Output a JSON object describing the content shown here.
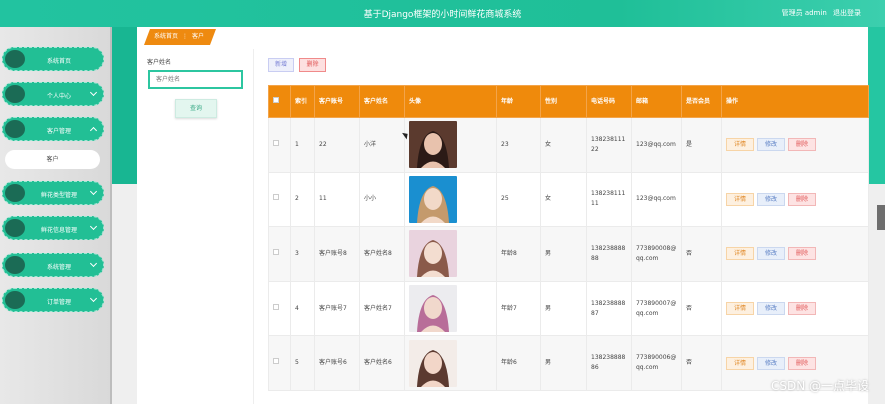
{
  "header": {
    "title": "基于Django框架的小时间鲜花商城系统",
    "user_label": "管理员 admin",
    "logout_label": "退出登录"
  },
  "sidebar": {
    "items": [
      {
        "label": "系统首页",
        "chevron": "none"
      },
      {
        "label": "个人中心",
        "chevron": "down"
      },
      {
        "label": "客户管理",
        "chevron": "up"
      },
      {
        "label": "鲜花类型管理",
        "chevron": "down"
      },
      {
        "label": "鲜花信息管理",
        "chevron": "down"
      },
      {
        "label": "系统管理",
        "chevron": "down"
      },
      {
        "label": "订单管理",
        "chevron": "down"
      }
    ],
    "active_sub": "客户"
  },
  "breadcrumb": {
    "home": "系统首页",
    "separator": "⋮",
    "current": "客户"
  },
  "search": {
    "label": "客户姓名",
    "placeholder": "客户姓名",
    "button": "查询"
  },
  "toolbar": {
    "add_label": "新增",
    "delete_label": "删除"
  },
  "table": {
    "headers": [
      "",
      "索引",
      "客户账号",
      "客户姓名",
      "头像",
      "年龄",
      "性别",
      "电话号码",
      "邮箱",
      "是否会员",
      "操作"
    ],
    "actions": {
      "detail": "详情",
      "edit": "修改",
      "delete": "删除"
    },
    "rows": [
      {
        "index": "1",
        "account": "22",
        "name": "小洋",
        "age": "23",
        "gender": "女",
        "phone": "13823811122",
        "email": "123@qq.com",
        "member": "是",
        "avatar_colors": [
          "#5b3a2e",
          "#e8c2ad",
          "#2b1a16"
        ]
      },
      {
        "index": "2",
        "account": "11",
        "name": "小小",
        "age": "25",
        "gender": "女",
        "phone": "13823811111",
        "email": "123@qq.com",
        "member": "",
        "avatar_colors": [
          "#1a8fd0",
          "#f2d9c8",
          "#c49a6c"
        ]
      },
      {
        "index": "3",
        "account": "客户账号8",
        "name": "客户姓名8",
        "age": "年龄8",
        "gender": "男",
        "phone": "13823888888",
        "email": "773890008@qq.com",
        "member": "否",
        "avatar_colors": [
          "#e9d3de",
          "#f3ddd0",
          "#8a5a4a"
        ]
      },
      {
        "index": "4",
        "account": "客户账号7",
        "name": "客户姓名7",
        "age": "年龄7",
        "gender": "男",
        "phone": "13823888887",
        "email": "773890007@qq.com",
        "member": "否",
        "avatar_colors": [
          "#ececef",
          "#f1d8cc",
          "#b86d99"
        ]
      },
      {
        "index": "5",
        "account": "客户账号6",
        "name": "客户姓名6",
        "age": "年龄6",
        "gender": "男",
        "phone": "13823888886",
        "email": "773890006@qq.com",
        "member": "否",
        "avatar_colors": [
          "#f3ece8",
          "#f2d6c8",
          "#5c3a30"
        ]
      }
    ]
  },
  "watermark": "CSDN @一点毕设"
}
